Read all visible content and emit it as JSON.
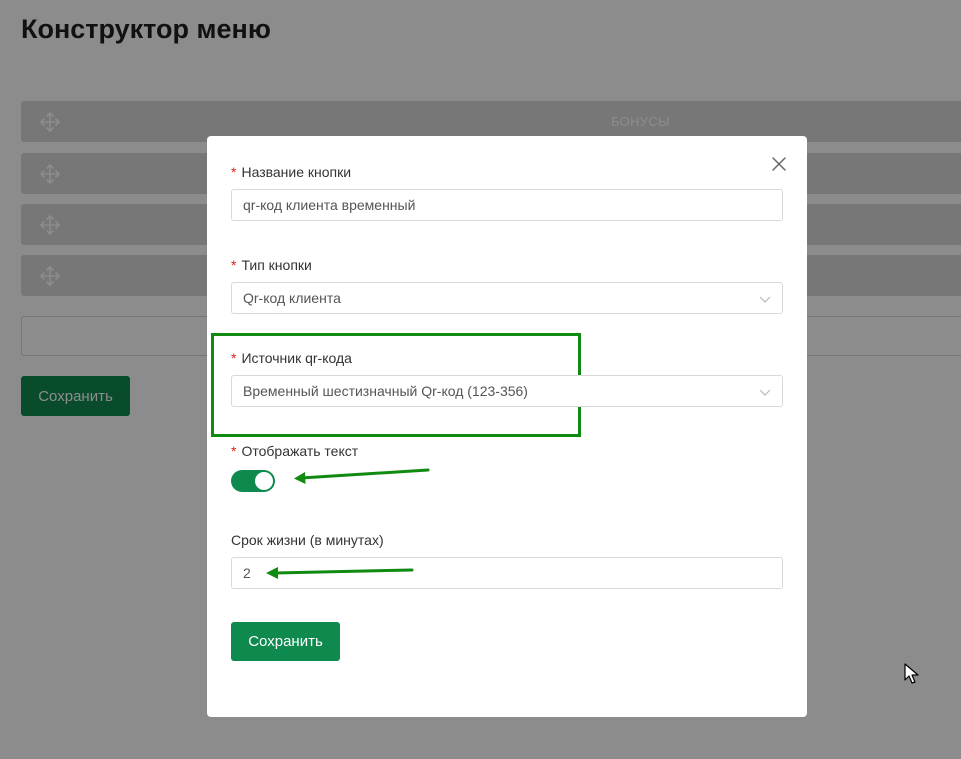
{
  "page": {
    "title": "Конструктор меню"
  },
  "menu_rows": [
    {
      "label": "БОНУСЫ",
      "icon": "move-icon"
    },
    {
      "label": "",
      "icon": "move-icon"
    },
    {
      "label": "",
      "icon": "move-icon"
    },
    {
      "label": "",
      "icon": "move-icon"
    }
  ],
  "background": {
    "save_label": "Сохранить"
  },
  "modal": {
    "close_icon": "close-icon",
    "fields": {
      "button_name": {
        "label": "Название кнопки",
        "required": true,
        "value": "qr-код клиента временный"
      },
      "button_type": {
        "label": "Тип кнопки",
        "required": true,
        "value": "Qr-код клиента"
      },
      "qr_source": {
        "label": "Источник qr-кода",
        "required": true,
        "value": "Временный шестизначный Qr-код (123-356)"
      },
      "show_text": {
        "label": "Отображать текст",
        "required": true,
        "value": true
      },
      "lifetime": {
        "label": "Срок жизни (в минутах)",
        "required": false,
        "value": "2"
      }
    },
    "save_label": "Сохранить"
  },
  "colors": {
    "accent": "#0f8a4f",
    "annotation": "#118a11",
    "required": "#e0201c"
  }
}
